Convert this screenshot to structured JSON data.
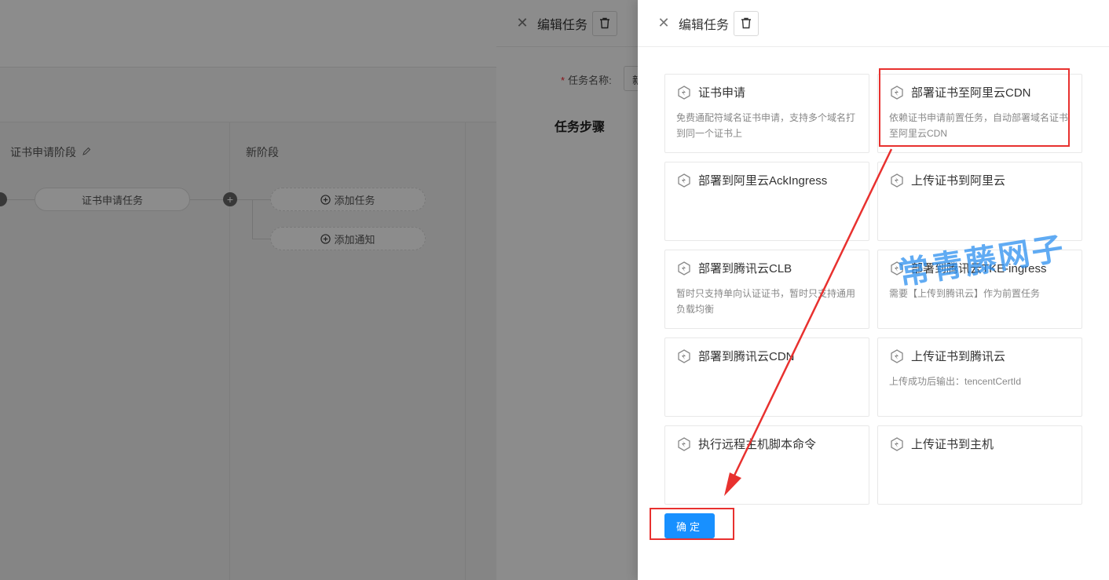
{
  "background": {
    "stages": [
      {
        "title": "证书申请阶段",
        "task": "证书申请任务"
      },
      {
        "title": "新阶段"
      }
    ],
    "add_task_label": "添加任务",
    "add_notify_label": "添加通知",
    "plus_glyph": "+"
  },
  "mid_drawer": {
    "title": "编辑任务",
    "field_label": "任务名称:",
    "field_value": "新",
    "section_title": "任务步骤"
  },
  "front_drawer": {
    "title": "编辑任务",
    "confirm_label": "确定",
    "plugins": [
      {
        "title": "证书申请",
        "desc": "免费通配符域名证书申请，支持多个域名打到同一个证书上"
      },
      {
        "title": "部署证书至阿里云CDN",
        "desc": "依赖证书申请前置任务，自动部署域名证书至阿里云CDN"
      },
      {
        "title": "部署到阿里云AckIngress",
        "desc": ""
      },
      {
        "title": "上传证书到阿里云",
        "desc": ""
      },
      {
        "title": "部署到腾讯云CLB",
        "desc": "暂时只支持单向认证证书，暂时只支持通用负载均衡"
      },
      {
        "title": "部署到腾讯云TKE-ingress",
        "desc": "需要【上传到腾讯云】作为前置任务"
      },
      {
        "title": "部署到腾讯云CDN",
        "desc": ""
      },
      {
        "title": "上传证书到腾讯云",
        "desc": "上传成功后输出：tencentCertId"
      },
      {
        "title": "执行远程主机脚本命令",
        "desc": ""
      },
      {
        "title": "上传证书到主机",
        "desc": ""
      }
    ]
  },
  "watermark": "常青藤网子",
  "colors": {
    "primary": "#1890ff",
    "annotation": "#e8312f",
    "watermark": "#2c8ff0"
  },
  "icons": {
    "close": "close-icon",
    "trash": "trash-icon",
    "plugin": "plugin-icon",
    "edit": "pencil-icon",
    "add": "plus-circle-icon"
  }
}
